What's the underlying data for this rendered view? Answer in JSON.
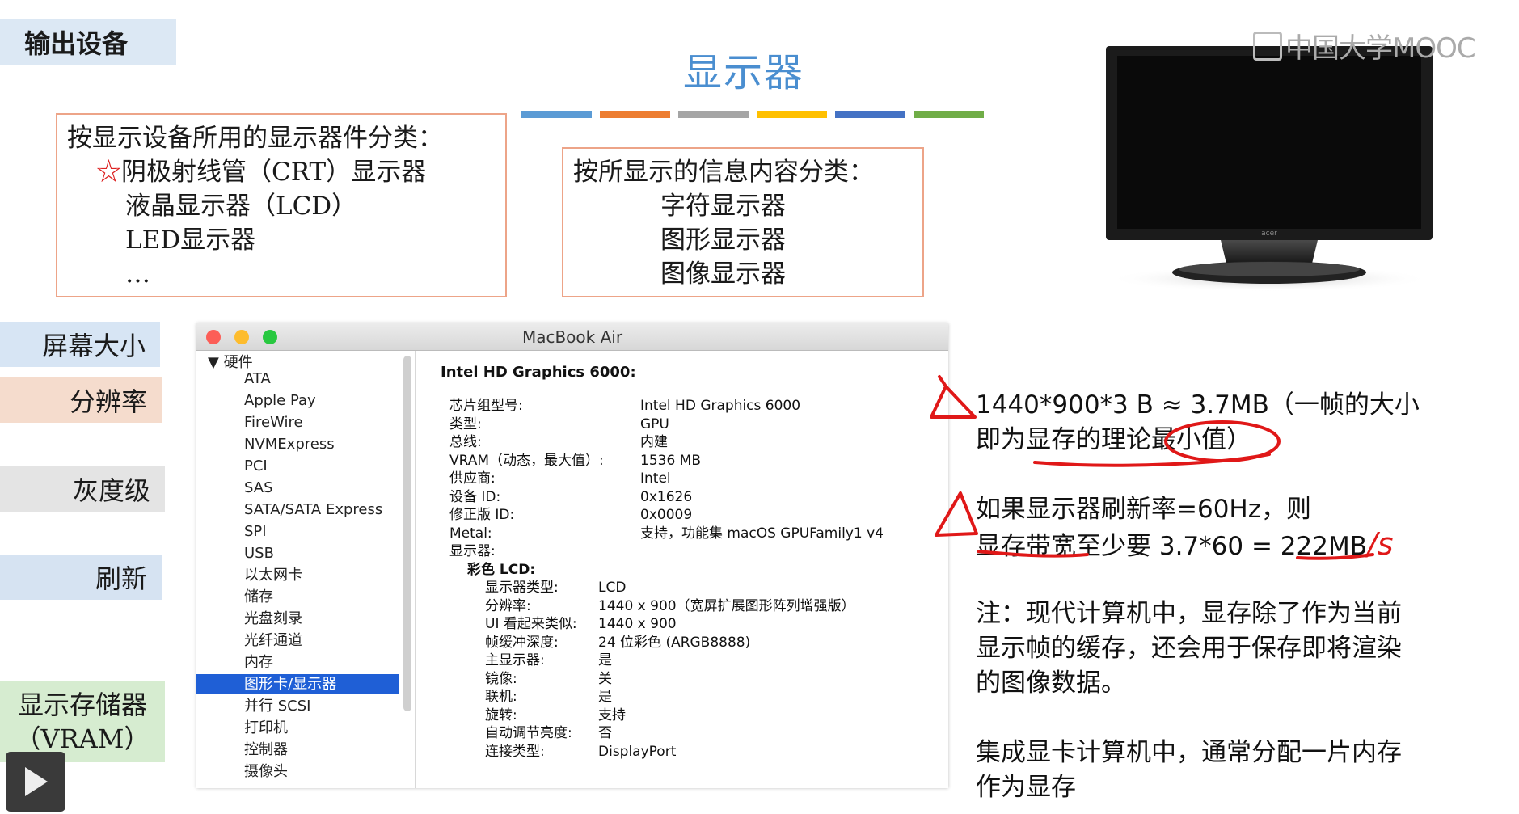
{
  "left_nav": {
    "section_title": "输出设备",
    "items": [
      "屏幕大小",
      "分辨率",
      "灰度级",
      "刷新",
      "显示存储器",
      "（VRAM）"
    ]
  },
  "header": {
    "title": "显示器",
    "bar_colors": [
      "#5b9bd5",
      "#ed7d31",
      "#a5a5a5",
      "#ffc000",
      "#4472c4",
      "#70ad47"
    ]
  },
  "classify_box_1": {
    "heading": "按显示设备所用的显示器件分类：",
    "star": "☆",
    "items": [
      "阴极射线管（CRT）显示器",
      "液晶显示器（LCD）",
      "LED显示器",
      "…"
    ]
  },
  "classify_box_2": {
    "heading": "按所显示的信息内容分类：",
    "items": [
      "字符显示器",
      "图形显示器",
      "图像显示器"
    ]
  },
  "watermark": "中国大学MOOC",
  "monitor_brand": "acer",
  "mac_window": {
    "title": "MacBook Air",
    "sidebar_root": "▼ 硬件",
    "sidebar_items": [
      "ATA",
      "Apple Pay",
      "FireWire",
      "NVMExpress",
      "PCI",
      "SAS",
      "SATA/SATA Express",
      "SPI",
      "USB",
      "以太网卡",
      "储存",
      "光盘刻录",
      "光纤通道",
      "内存",
      "图形卡/显示器",
      "并行 SCSI",
      "打印机",
      "控制器",
      "摄像头"
    ],
    "selected_item": "图形卡/显示器",
    "detail_title": "Intel HD Graphics 6000:",
    "gpu_rows": [
      {
        "k": "芯片组型号:",
        "v": "Intel HD Graphics 6000"
      },
      {
        "k": "类型:",
        "v": "GPU"
      },
      {
        "k": "总线:",
        "v": "内建"
      },
      {
        "k": "VRAM（动态，最大值）:",
        "v": "1536 MB"
      },
      {
        "k": "供应商:",
        "v": "Intel"
      },
      {
        "k": "设备 ID:",
        "v": "0x1626"
      },
      {
        "k": "修正版 ID:",
        "v": "0x0009"
      },
      {
        "k": "Metal:",
        "v": "支持，功能集 macOS GPUFamily1 v4"
      },
      {
        "k": "显示器:",
        "v": ""
      }
    ],
    "display_name": "彩色 LCD:",
    "display_rows": [
      {
        "k": "显示器类型:",
        "v": "LCD"
      },
      {
        "k": "分辨率:",
        "v": "1440 x 900（宽屏扩展图形阵列增强版）"
      },
      {
        "k": "UI 看起来类似:",
        "v": "1440 x 900"
      },
      {
        "k": "帧缓冲深度:",
        "v": "24 位彩色 (ARGB8888)"
      },
      {
        "k": "主显示器:",
        "v": "是"
      },
      {
        "k": "镜像:",
        "v": "关"
      },
      {
        "k": "联机:",
        "v": "是"
      },
      {
        "k": "旋转:",
        "v": "支持"
      },
      {
        "k": "自动调节亮度:",
        "v": "否"
      },
      {
        "k": "连接类型:",
        "v": "DisplayPort"
      }
    ]
  },
  "notes": {
    "line1a": "1440*900*3 B ≈ 3.7MB（一帧的大小",
    "line1b": "即为显存的理论最小值）",
    "line2a": "如果显示器刷新率=60Hz，则",
    "line2b": "显存带宽至少要 3.7*60 = 222MB",
    "handwritten_suffix": "/s",
    "note3a": "注：现代计算机中，显存除了作为当前",
    "note3b": "显示帧的缓存，还会用于保存即将渲染",
    "note3c": "的图像数据。",
    "note4a": "集成显卡计算机中，通常分配一片内存",
    "note4b": "作为显存"
  }
}
